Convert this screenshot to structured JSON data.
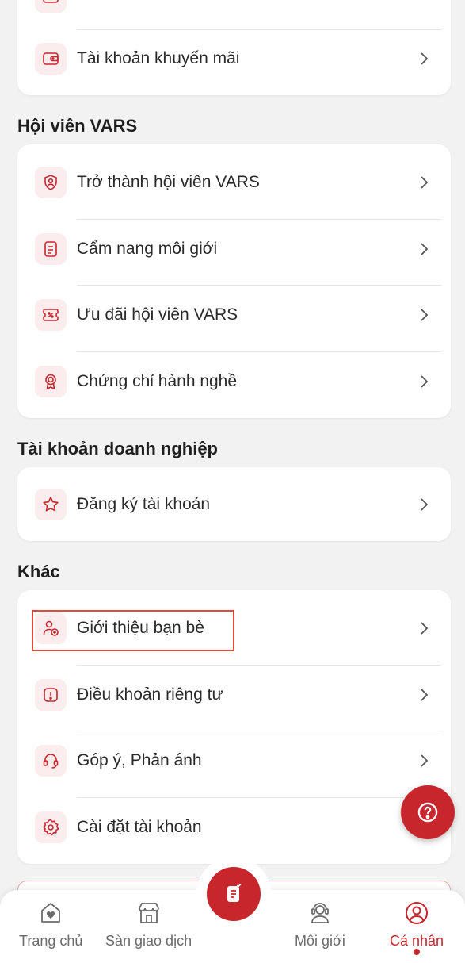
{
  "top_card": {
    "items": [
      {
        "label": "Tài khoản khuyến mãi",
        "icon": "wallet-icon"
      }
    ]
  },
  "sections": {
    "vars": {
      "title": "Hội viên VARS",
      "items": [
        {
          "label": "Trở thành hội viên VARS",
          "icon": "shield-user-icon"
        },
        {
          "label": "Cẩm nang môi giới",
          "icon": "handbook-icon"
        },
        {
          "label": "Ưu đãi hội viên VARS",
          "icon": "coupon-icon"
        },
        {
          "label": "Chứng chỉ hành nghề",
          "icon": "certificate-icon"
        }
      ]
    },
    "business": {
      "title": "Tài khoản doanh nghiệp",
      "items": [
        {
          "label": "Đăng ký tài khoản",
          "icon": "star-icon"
        }
      ]
    },
    "other": {
      "title": "Khác",
      "items": [
        {
          "label": "Giới thiệu bạn bè",
          "icon": "user-add-icon"
        },
        {
          "label": "Điều khoản riêng tư",
          "icon": "alert-icon"
        },
        {
          "label": "Góp ý, Phản ánh",
          "icon": "headset-icon"
        },
        {
          "label": "Cài đặt tài khoản",
          "icon": "gear-icon"
        }
      ]
    }
  },
  "fab": {
    "icon": "help-icon"
  },
  "tabbar": {
    "tabs": [
      {
        "label": "Trang chủ",
        "icon": "home-icon",
        "active": false
      },
      {
        "label": "Sàn giao dịch",
        "icon": "store-icon",
        "active": false
      },
      {
        "label": "",
        "icon": "post-icon",
        "active": false
      },
      {
        "label": "Môi giới",
        "icon": "agent-icon",
        "active": false
      },
      {
        "label": "Cá nhân",
        "icon": "profile-icon",
        "active": true
      }
    ]
  },
  "colors": {
    "accent": "#c8262d",
    "icon_bg": "#fbeced",
    "page_bg": "#f2f2f3"
  }
}
